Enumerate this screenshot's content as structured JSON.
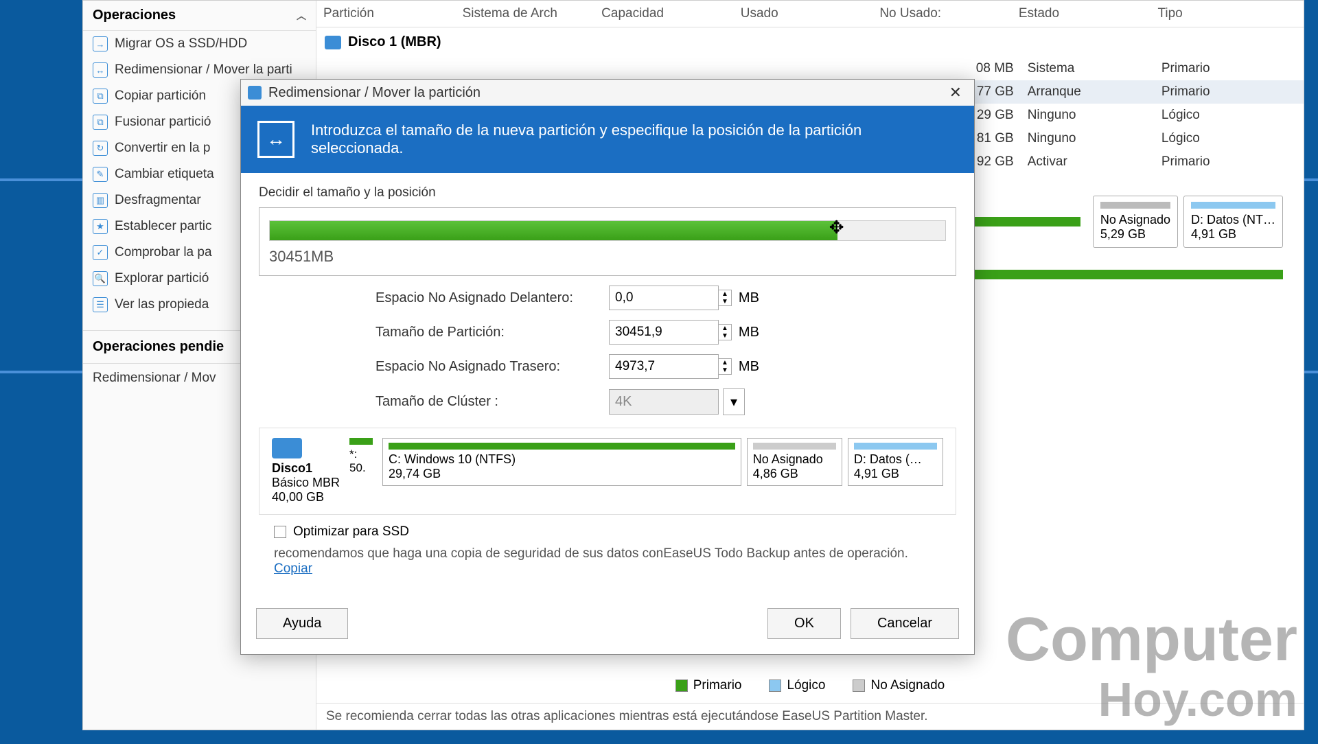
{
  "sidebar": {
    "header": "Operaciones",
    "items": [
      {
        "label": "Migrar OS a SSD/HDD",
        "icon": "→"
      },
      {
        "label": "Redimensionar / Mover la parti",
        "icon": "↔"
      },
      {
        "label": "Copiar partición",
        "icon": "⧉"
      },
      {
        "label": "Fusionar partició",
        "icon": "⧉"
      },
      {
        "label": "Convertir en la p",
        "icon": "↻"
      },
      {
        "label": "Cambiar etiqueta",
        "icon": "✎"
      },
      {
        "label": "Desfragmentar",
        "icon": "▥"
      },
      {
        "label": "Establecer partic",
        "icon": "★"
      },
      {
        "label": "Comprobar la pa",
        "icon": "✓"
      },
      {
        "label": "Explorar partició",
        "icon": "🔍"
      },
      {
        "label": "Ver las propieda",
        "icon": "☰"
      }
    ],
    "pending_header": "Operaciones pendie",
    "pending_item": "Redimensionar / Mov"
  },
  "table": {
    "headers": [
      "Partición",
      "Sistema de Arch",
      "Capacidad",
      "Usado",
      "No Usado:",
      "Estado",
      "Tipo"
    ],
    "disk_label": "Disco 1 (MBR)",
    "rows": [
      {
        "size": "08 MB",
        "state": "Sistema",
        "type": "Primario"
      },
      {
        "size": "77 GB",
        "state": "Arranque",
        "type": "Primario",
        "selected": true
      },
      {
        "size": "29 GB",
        "state": "Ninguno",
        "type": "Lógico"
      },
      {
        "size": "81 GB",
        "state": "Ninguno",
        "type": "Lógico"
      },
      {
        "size": "92 GB",
        "state": "Activar",
        "type": "Primario"
      }
    ]
  },
  "map_segments": [
    {
      "label": "No Asignado",
      "sub": "5,29 GB",
      "color": "#bbb"
    },
    {
      "label": "D: Datos (NT…",
      "sub": "4,91 GB",
      "color": "#8cc8f0"
    }
  ],
  "legend": [
    {
      "label": "Primario",
      "color": "#3aa018"
    },
    {
      "label": "Lógico",
      "color": "#8cc8f0"
    },
    {
      "label": "No Asignado",
      "color": "#ccc"
    }
  ],
  "status_bar": "Se recomienda cerrar todas las otras aplicaciones mientras está ejecutándose EaseUS Partition Master.",
  "dialog": {
    "title": "Redimensionar / Mover la partición",
    "banner": "Introduzca el tamaño de la nueva partición y especifique la posición de la partición seleccionada.",
    "section_label": "Decidir el tamaño y la posición",
    "slider_value": "30451MB",
    "fields": {
      "front_label": "Espacio No Asignado Delantero:",
      "front_value": "0,0",
      "size_label": "Tamaño de Partición:",
      "size_value": "30451,9",
      "rear_label": "Espacio No Asignado Trasero:",
      "rear_value": "4973,7",
      "cluster_label": "Tamaño de Clúster :",
      "cluster_value": "4K",
      "unit": "MB"
    },
    "preview": {
      "disk_name": "Disco1",
      "disk_type": "Básico MBR",
      "disk_size": "40,00 GB",
      "tiny_label": "*:",
      "tiny_size": "50.",
      "segments": [
        {
          "label": "C: Windows 10 (NTFS)",
          "sub": "29,74 GB",
          "color": "#3aa018",
          "flex": "5"
        },
        {
          "label": "No Asignado",
          "sub": "4,86 GB",
          "color": "#ccc",
          "flex": "1.2"
        },
        {
          "label": "D: Datos (…",
          "sub": "4,91 GB",
          "color": "#8cc8f0",
          "flex": "1.2"
        }
      ]
    },
    "ssd_label": "Optimizar para SSD",
    "recommend": "recomendamos que haga una copia de seguridad de sus datos conEaseUS Todo Backup antes de operación.",
    "recommend_link": "Copiar",
    "buttons": {
      "help": "Ayuda",
      "ok": "OK",
      "cancel": "Cancelar"
    }
  },
  "watermark": {
    "l1": "Computer",
    "l2": "Hoy",
    "l3": ".com"
  }
}
